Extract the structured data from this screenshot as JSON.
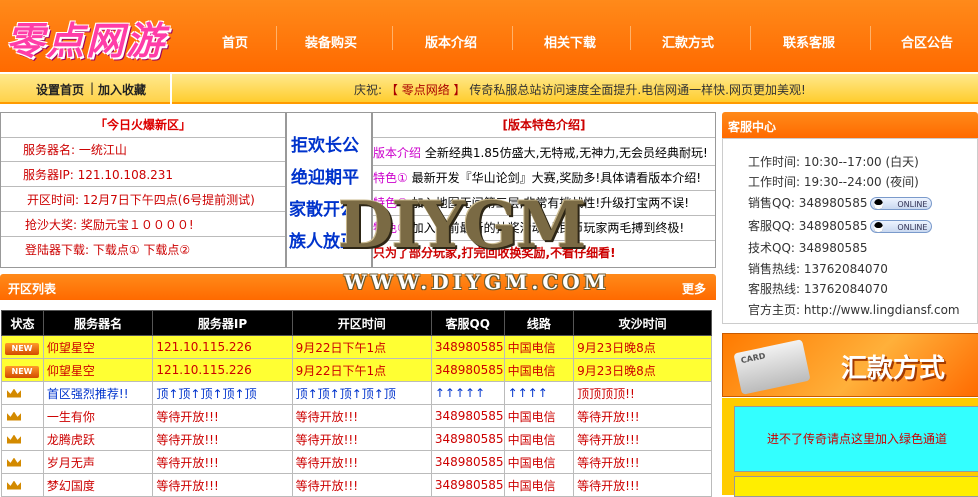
{
  "header": {
    "logo": "零点网游",
    "nav": [
      "首页",
      "装备购买",
      "版本介绍",
      "相关下载",
      "汇款方式",
      "联系客服",
      "合区公告"
    ]
  },
  "topbar": {
    "set_home": "设置首页",
    "separator": "|",
    "add_fav": "加入收藏",
    "notice_prefix": "庆祝:",
    "notice_highlight": "【 零点网络 】",
    "notice_text": "传奇私服总站访问速度全面提升.电信网通一样快.网页更加美观!"
  },
  "today": {
    "title": "「今日火爆新区」",
    "rows": [
      "服务器名:   一统江山",
      "服务器IP:  121.10.108.231",
      "开区时间: 12月7日下午四点(6号提前测试)",
      "抢沙大奖: 奖励元宝１００００!",
      "登陆器下载:  下载点①      下载点②"
    ]
  },
  "slogan": [
    "拒欢长公",
    "绝迎期平",
    "家散开公",
    "族人放正"
  ],
  "features": {
    "title": "[版本特色介绍]",
    "rows": [
      {
        "tag": "版本介绍",
        "text": "全新经典1.85仿盛大,无特戒,无神力,无会员经典耐玩!"
      },
      {
        "tag": "特色①",
        "text": "最新开发『华山论剑』大赛,奖励多!具体请看版本介绍!"
      },
      {
        "tag": "特色②",
        "text": "加入地图无间第三层,非常有挑战性!升级打宝两不误!"
      },
      {
        "tag": "特色③",
        "text": "加入目前最新的抽奖活动,人民币玩家两毛搏到终极!"
      },
      {
        "tag": "",
        "text": "只为了部分玩家,打完回收换奖励,不看仔细看!"
      }
    ]
  },
  "server_list": {
    "title": "开区列表",
    "more": "更多",
    "headers": [
      "状态",
      "服务器名",
      "服务器IP",
      "开区时间",
      "客服QQ",
      "线路",
      "攻沙时间"
    ],
    "rows": [
      {
        "status": "new",
        "name": "仰望星空",
        "ip": "121.10.115.226",
        "time": "9月22日下午1点",
        "qq": "348980585",
        "line": "中国电信",
        "siege": "9月23日晚8点"
      },
      {
        "status": "new",
        "name": "仰望星空",
        "ip": "121.10.115.226",
        "time": "9月22日下午1点",
        "qq": "348980585",
        "line": "中国电信",
        "siege": "9月23日晚8点"
      },
      {
        "status": "crown",
        "name": "首区强烈推荐!!",
        "ip": "顶↑顶↑顶↑顶↑顶",
        "time": "顶↑顶↑顶↑顶↑顶",
        "qq": "↑↑↑↑↑",
        "line": "↑↑↑↑",
        "siege": "顶顶顶顶!!"
      },
      {
        "status": "crown",
        "name": "一生有你",
        "ip": "等待开放!!!",
        "time": "等待开放!!!",
        "qq": "348980585",
        "line": "中国电信",
        "siege": "等待开放!!!"
      },
      {
        "status": "crown",
        "name": "龙腾虎跃",
        "ip": "等待开放!!!",
        "time": "等待开放!!!",
        "qq": "348980585",
        "line": "中国电信",
        "siege": "等待开放!!!"
      },
      {
        "status": "crown",
        "name": "岁月无声",
        "ip": "等待开放!!!",
        "time": "等待开放!!!",
        "qq": "348980585",
        "line": "中国电信",
        "siege": "等待开放!!!"
      },
      {
        "status": "crown",
        "name": "梦幻国度",
        "ip": "等待开放!!!",
        "time": "等待开放!!!",
        "qq": "348980585",
        "line": "中国电信",
        "siege": "等待开放!!!"
      }
    ]
  },
  "service": {
    "title": "客服中心",
    "work1": "工作时间:  10:30--17:00  (白天)",
    "work2": "工作时间:  19:30--24:00  (夜间)",
    "sales_qq": "销售QQ:  348980585",
    "cs_qq": "客服QQ:  348980585",
    "tech_qq": "技术QQ:  348980585",
    "sales_tel": "销售热线:  13762084070",
    "cs_tel": "客服热线:  13762084070",
    "home": "官方主页:  http://www.lingdiansf.com",
    "online": "ONLINE"
  },
  "remit_banner": {
    "card": "CARD",
    "title": "汇款方式"
  },
  "green_channel": "进不了传奇请点这里加入绿色通道",
  "watermark": {
    "big": "DIYGM",
    "url": "WWW.DIYGM.COM"
  },
  "colors": {
    "orange": "#ff6a00",
    "yellow": "#ffff33",
    "cyan": "#33ffff",
    "red": "#cc0000",
    "blue": "#0033cc"
  }
}
